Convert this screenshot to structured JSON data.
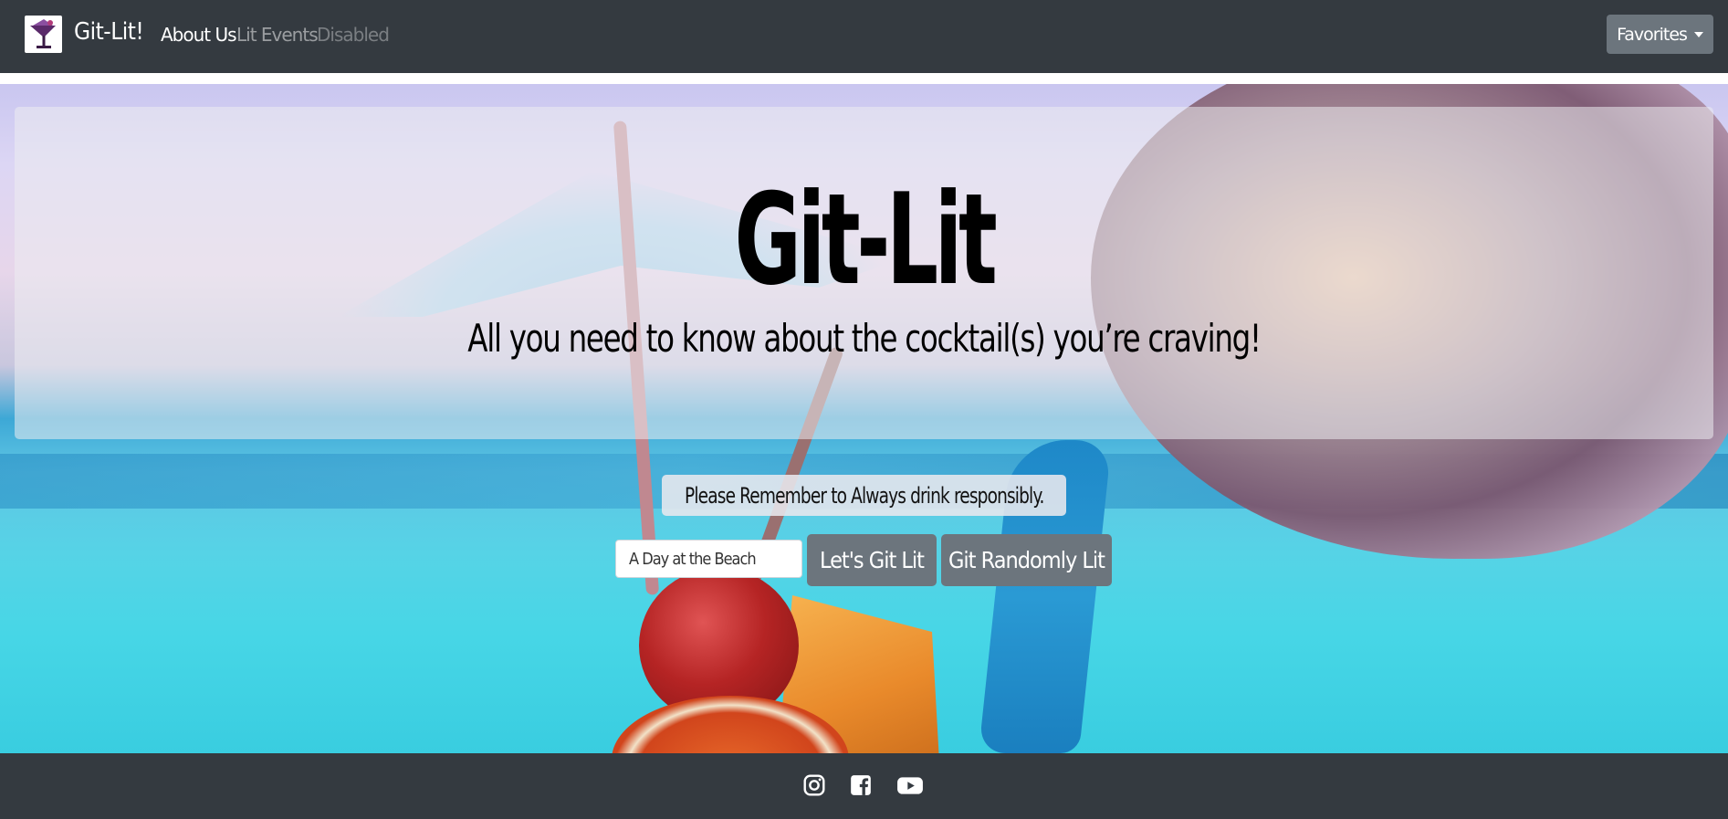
{
  "navbar": {
    "brand": "Git-Lit!",
    "links": [
      "About Us",
      "Lit Events",
      "Disabled"
    ],
    "dropdown_label": "Favorites"
  },
  "hero": {
    "title": "Git-Lit",
    "subtitle": "All you need to know about the cocktail(s) you’re craving!",
    "notice": "Please Remember to Always drink responsibly."
  },
  "search": {
    "value": "A Day at the Beach",
    "submit_label": "Let's Git Lit",
    "random_label": "Git Randomly Lit"
  },
  "footer": {
    "icons": [
      "instagram-icon",
      "facebook-icon",
      "youtube-icon"
    ]
  },
  "colors": {
    "navbar_bg": "#343a40",
    "button_bg": "#6c757d",
    "text_primary": "#000000"
  }
}
